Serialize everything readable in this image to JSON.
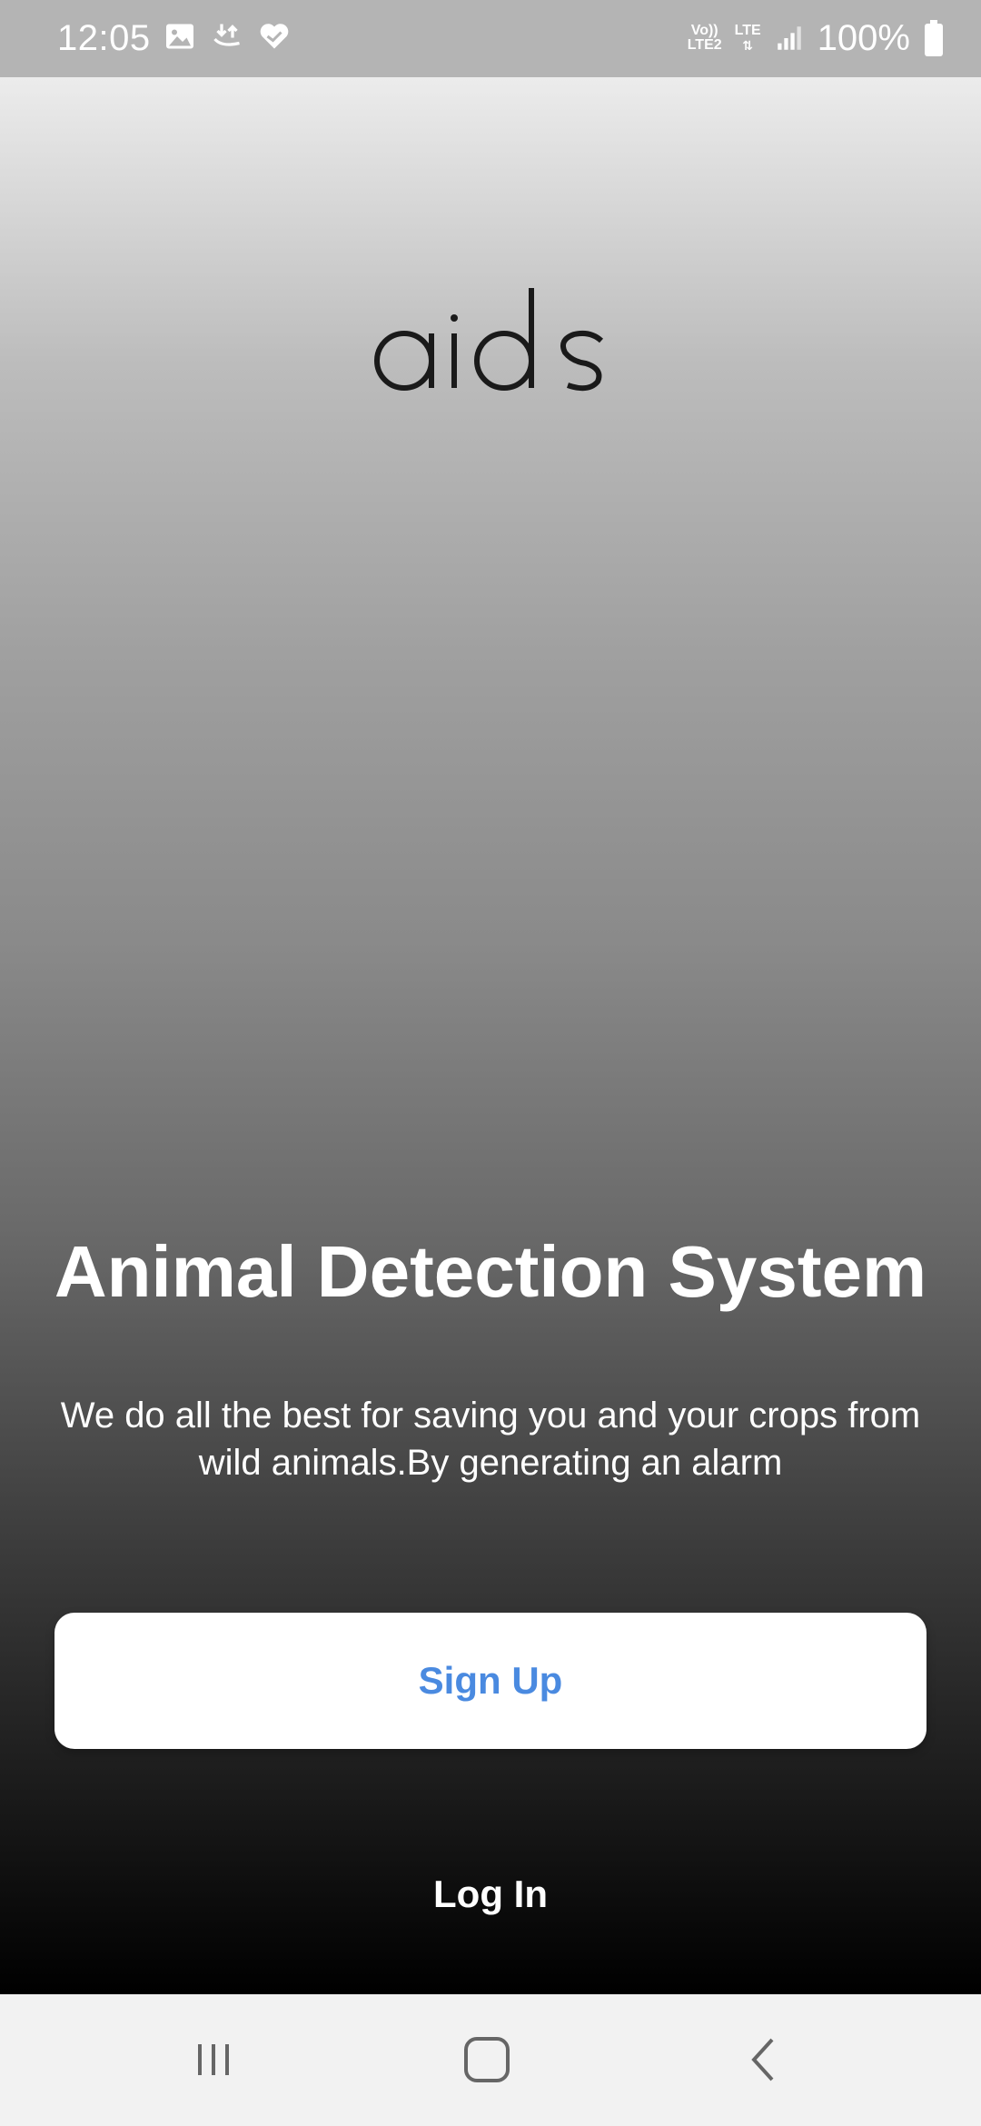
{
  "status_bar": {
    "time": "12:05",
    "icons_left": [
      "gallery-icon",
      "download-sync-icon",
      "health-heart-icon"
    ],
    "volte_label_top": "Vo))",
    "volte_label_bottom": "LTE2",
    "lte_label": "LTE",
    "battery_percent": "100%",
    "icons_right": [
      "signal-icon",
      "battery-icon"
    ]
  },
  "app": {
    "logo_text": "aids",
    "headline": "Animal Detection System",
    "subtitle": "We do all the best for saving you and your crops from wild animals.By generating an alarm",
    "signup_label": "Sign Up",
    "login_label": "Log In"
  },
  "colors": {
    "status_bar_bg": "#b4b4b4",
    "signup_text": "#4a8ae0",
    "nav_bar_bg": "#f2f2f2",
    "gradient_top": "#ececec",
    "gradient_bottom": "#000000"
  },
  "nav_bar": {
    "buttons": [
      "recent-apps-icon",
      "home-icon",
      "back-icon"
    ]
  }
}
